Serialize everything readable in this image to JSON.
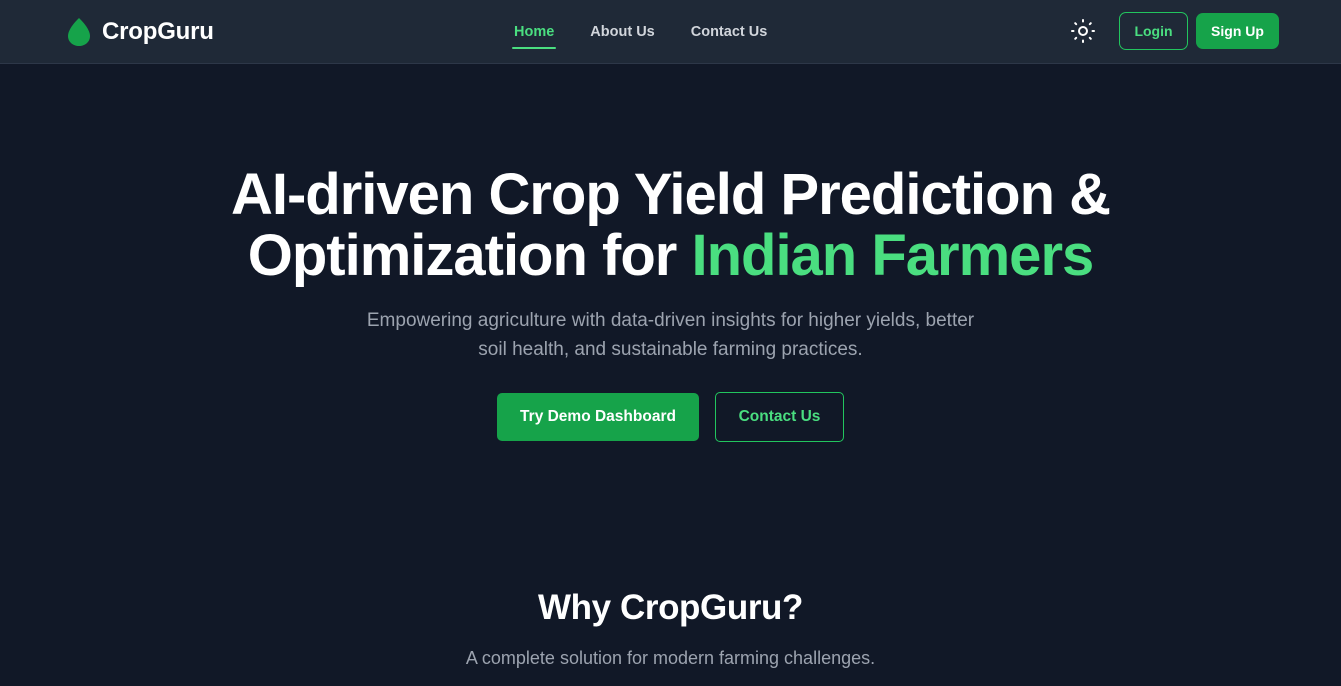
{
  "brand": {
    "name": "CropGuru",
    "icon": "leaf-icon",
    "color": "#16a34a"
  },
  "nav": {
    "links": [
      {
        "label": "Home",
        "active": true
      },
      {
        "label": "About Us",
        "active": false
      },
      {
        "label": "Contact Us",
        "active": false
      }
    ],
    "theme_toggle_icon": "sun-icon",
    "login_label": "Login",
    "signup_label": "Sign Up"
  },
  "hero": {
    "title_line1": "AI-driven Crop Yield Prediction &",
    "title_line2_prefix": "Optimization for ",
    "title_line2_accent": "Indian Farmers",
    "subtitle_line1": "Empowering agriculture with data-driven insights for higher yields, better",
    "subtitle_line2": "soil health, and sustainable farming practices.",
    "primary_button": "Try Demo Dashboard",
    "secondary_button": "Contact Us"
  },
  "why": {
    "title": "Why CropGuru?",
    "subtitle": "A complete solution for modern farming challenges."
  },
  "colors": {
    "background": "#111827",
    "navbar": "#1f2937",
    "accent": "#4ade80",
    "button_green": "#16a34a",
    "muted_text": "#9ca3af"
  }
}
